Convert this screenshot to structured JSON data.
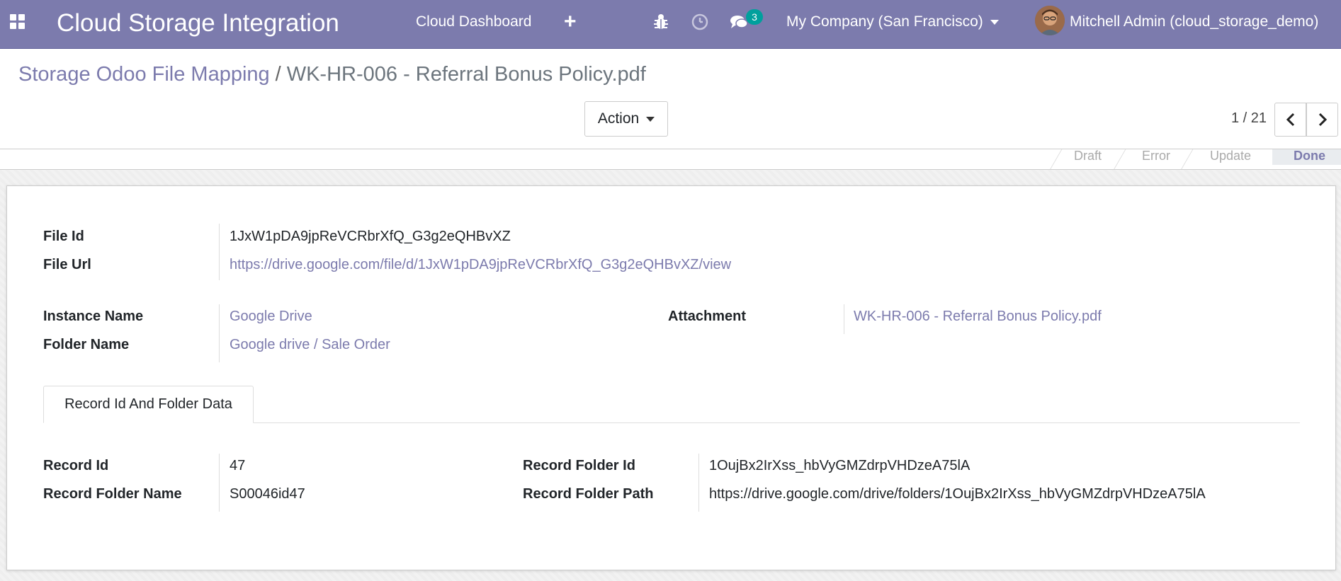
{
  "navbar": {
    "app_title": "Cloud Storage Integration",
    "menu_item": "Cloud Dashboard",
    "plus_icon": "+",
    "chat_count": "3",
    "company": "My Company (San Francisco)",
    "user": "Mitchell Admin (cloud_storage_demo)",
    "icons": [
      "apps-grid-icon",
      "bug-icon",
      "clock-icon",
      "chat-icon"
    ]
  },
  "breadcrumb": {
    "parent": "Storage Odoo File Mapping",
    "separator": "/",
    "current": "WK-HR-006 - Referral Bonus Policy.pdf"
  },
  "control_panel": {
    "action_label": "Action",
    "pager": "1 / 21"
  },
  "statusbar": {
    "stages": [
      "Draft",
      "Error",
      "Update",
      "Done"
    ],
    "active": "Done"
  },
  "form": {
    "file_id": {
      "label": "File Id",
      "value": "1JxW1pDA9jpReVCRbrXfQ_G3g2eQHBvXZ"
    },
    "file_url": {
      "label": "File Url",
      "value": "https://drive.google.com/file/d/1JxW1pDA9jpReVCRbrXfQ_G3g2eQHBvXZ/view"
    },
    "instance_name": {
      "label": "Instance Name",
      "value": "Google Drive"
    },
    "folder_name": {
      "label": "Folder Name",
      "value": "Google drive / Sale Order"
    },
    "attachment": {
      "label": "Attachment",
      "value": "WK-HR-006 - Referral Bonus Policy.pdf"
    }
  },
  "tab": {
    "label": "Record Id And Folder Data",
    "record_id": {
      "label": "Record Id",
      "value": "47"
    },
    "record_folder_name": {
      "label": "Record Folder Name",
      "value": "S00046id47"
    },
    "record_folder_id": {
      "label": "Record Folder Id",
      "value": "1OujBx2IrXss_hbVyGMZdrpVHDzeA75lA"
    },
    "record_folder_path": {
      "label": "Record Folder Path",
      "value": "https://drive.google.com/drive/folders/1OujBx2IrXss_hbVyGMZdrpVHDzeA75lA"
    }
  },
  "colors": {
    "brand": "#7c7bad",
    "badge": "#00a09d"
  }
}
